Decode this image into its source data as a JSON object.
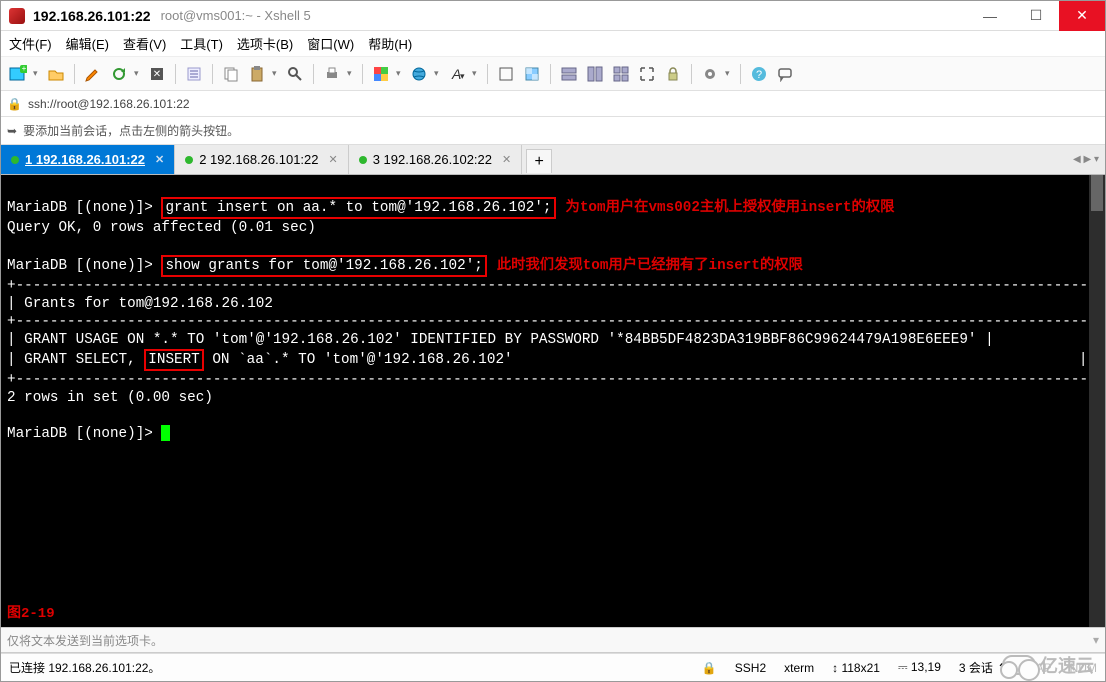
{
  "window": {
    "title_main": "192.168.26.101:22",
    "title_sub": "root@vms001:~ - Xshell 5"
  },
  "menus": {
    "file": "文件(F)",
    "edit": "编辑(E)",
    "view": "查看(V)",
    "tools": "工具(T)",
    "tabs": "选项卡(B)",
    "window": "窗口(W)",
    "help": "帮助(H)"
  },
  "addressbar": {
    "lock": "🔒",
    "url": "ssh://root@192.168.26.101:22"
  },
  "hintbar": {
    "arrow": "➥",
    "text": "要添加当前会话，点击左侧的箭头按钮。"
  },
  "tabs": [
    {
      "label": "1 192.168.26.101:22",
      "active": true
    },
    {
      "label": "2 192.168.26.101:22",
      "active": false
    },
    {
      "label": "3 192.168.26.102:22",
      "active": false
    }
  ],
  "tab_add": "+",
  "terminal": {
    "lines": {
      "l1_pre": "MariaDB [(none)]> ",
      "l1_cmd": "grant insert on aa.* to tom@'192.168.26.102';",
      "l1_note": "为tom用户在vms002主机上授权使用insert的权限",
      "l2": "Query OK, 0 rows affected (0.01 sec)",
      "blank1": "",
      "l3_pre": "MariaDB [(none)]> ",
      "l3_cmd": "show grants for tom@'192.168.26.102';",
      "l3_note": "此时我们发现tom用户已经拥有了insert的权限",
      "div1": "+------------------------------------------------------------------------------------------------------------------------------+",
      "hdr": "| Grants for tom@192.168.26.102                                                                                                |",
      "div2": "+------------------------------------------------------------------------------------------------------------------------------+",
      "row1": "| GRANT USAGE ON *.* TO 'tom'@'192.168.26.102' IDENTIFIED BY PASSWORD '*84BB5DF4823DA319BBF86C99624479A198E6EEE9' |",
      "row2_a": "| GRANT SELECT, ",
      "row2_b": "INSERT",
      "row2_c": " ON `aa`.* TO 'tom'@'192.168.26.102'                                                                  |",
      "div3": "+------------------------------------------------------------------------------------------------------------------------------+",
      "sum": "2 rows in set (0.00 sec)",
      "blank2": "",
      "prompt": "MariaDB [(none)]> "
    },
    "fig_label": "图2-19"
  },
  "inputbar": {
    "placeholder": "仅将文本发送到当前选项卡。"
  },
  "statusbar": {
    "conn": "已连接 192.168.26.101:22。",
    "ssh": "SSH2",
    "ssh_icon": "🔒",
    "term": "xterm",
    "size": "118x21",
    "size_icon": "↕",
    "pos": "13,19",
    "pos_icon": "⎓",
    "sessions": "3 会话",
    "sessions_arrows": "⇅",
    "cap": "CAP",
    "num": "NUM"
  },
  "watermark": "亿速云",
  "icons": {
    "new": "new-tab-icon",
    "open": "open-icon",
    "pencil": "edit-icon",
    "reconnect": "reconnect-icon",
    "disconnect": "disconnect-icon",
    "copy": "copy-icon",
    "paste": "paste-icon",
    "find": "find-icon",
    "print": "print-icon",
    "color": "color-icon",
    "globe": "globe-icon",
    "font": "font-icon",
    "fullscreen": "fullscreen-icon",
    "transp": "transparency-icon",
    "tile1": "tile-h-icon",
    "tile2": "tile-v-icon",
    "tile3": "tile-grid-icon",
    "expand": "expand-icon",
    "lock": "lock-icon",
    "settings": "settings-icon",
    "help": "help-icon",
    "chat": "chat-icon"
  }
}
